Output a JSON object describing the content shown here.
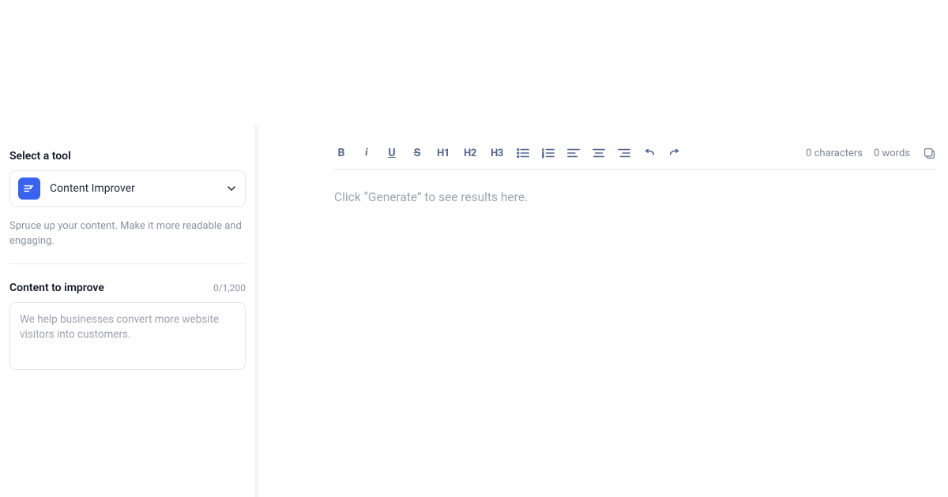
{
  "sidebar": {
    "select_label": "Select a tool",
    "tool_name": "Content Improver",
    "tool_desc": "Spruce up your content. Make it more readable and engaging.",
    "content_label": "Content to improve",
    "content_count": "0/1,200",
    "content_placeholder": "We help businesses convert more website visitors into customers."
  },
  "toolbar": {
    "bold": "B",
    "italic": "i",
    "underline": "U",
    "strike": "S",
    "h1": "H1",
    "h2": "H2",
    "h3": "H3"
  },
  "stats": {
    "characters": "0 characters",
    "words": "0 words"
  },
  "editor": {
    "placeholder": "Click “Generate” to see results here."
  }
}
